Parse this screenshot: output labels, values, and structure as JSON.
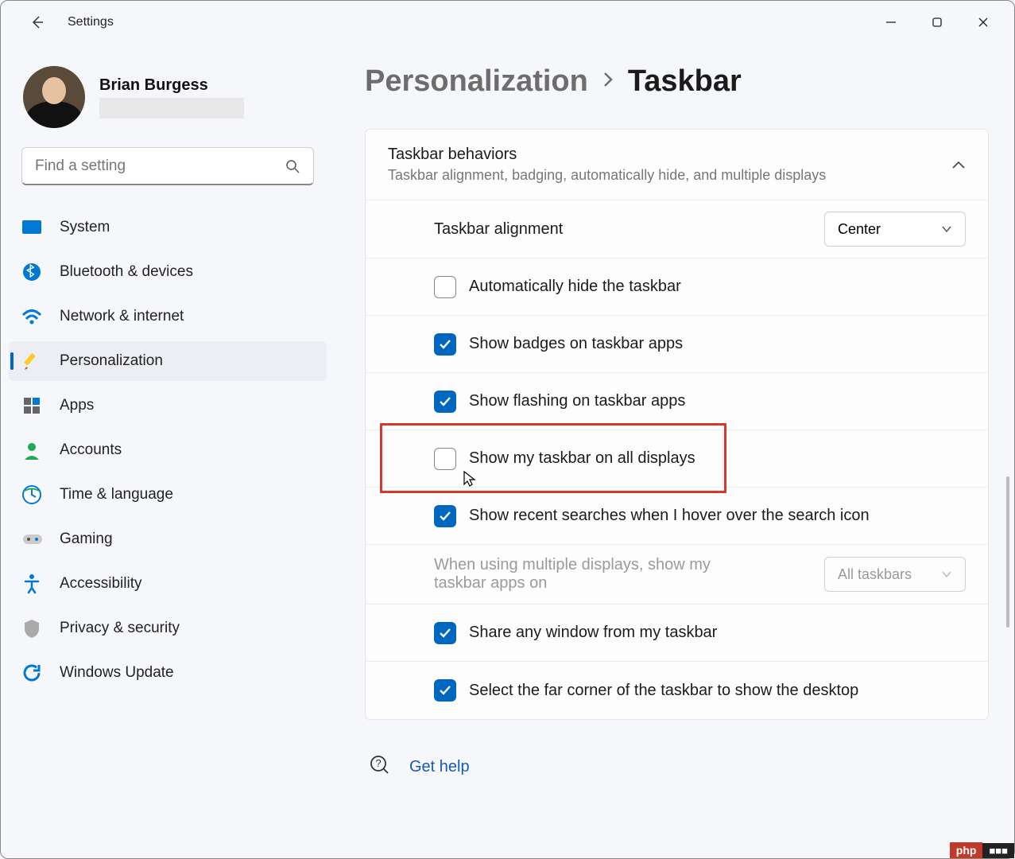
{
  "window": {
    "title": "Settings"
  },
  "profile": {
    "name": "Brian Burgess"
  },
  "search": {
    "placeholder": "Find a setting"
  },
  "sidebar": {
    "items": [
      {
        "label": "System"
      },
      {
        "label": "Bluetooth & devices"
      },
      {
        "label": "Network & internet"
      },
      {
        "label": "Personalization"
      },
      {
        "label": "Apps"
      },
      {
        "label": "Accounts"
      },
      {
        "label": "Time & language"
      },
      {
        "label": "Gaming"
      },
      {
        "label": "Accessibility"
      },
      {
        "label": "Privacy & security"
      },
      {
        "label": "Windows Update"
      }
    ]
  },
  "breadcrumb": {
    "parent": "Personalization",
    "current": "Taskbar"
  },
  "panel": {
    "title": "Taskbar behaviors",
    "subtitle": "Taskbar alignment, badging, automatically hide, and multiple displays"
  },
  "rows": {
    "alignment": {
      "label": "Taskbar alignment",
      "value": "Center"
    },
    "autohide": {
      "label": "Automatically hide the taskbar",
      "checked": false
    },
    "badges": {
      "label": "Show badges on taskbar apps",
      "checked": true
    },
    "flashing": {
      "label": "Show flashing on taskbar apps",
      "checked": true
    },
    "alldisplays": {
      "label": "Show my taskbar on all displays",
      "checked": false
    },
    "recentsearch": {
      "label": "Show recent searches when I hover over the search icon",
      "checked": true
    },
    "multidisplay": {
      "label": "When using multiple displays, show my taskbar apps on",
      "value": "All taskbars"
    },
    "sharewindow": {
      "label": "Share any window from my taskbar",
      "checked": true
    },
    "farcorner": {
      "label": "Select the far corner of the taskbar to show the desktop",
      "checked": true
    }
  },
  "help": {
    "label": "Get help"
  },
  "footer": {
    "php": "php",
    "cn": "■■■"
  }
}
